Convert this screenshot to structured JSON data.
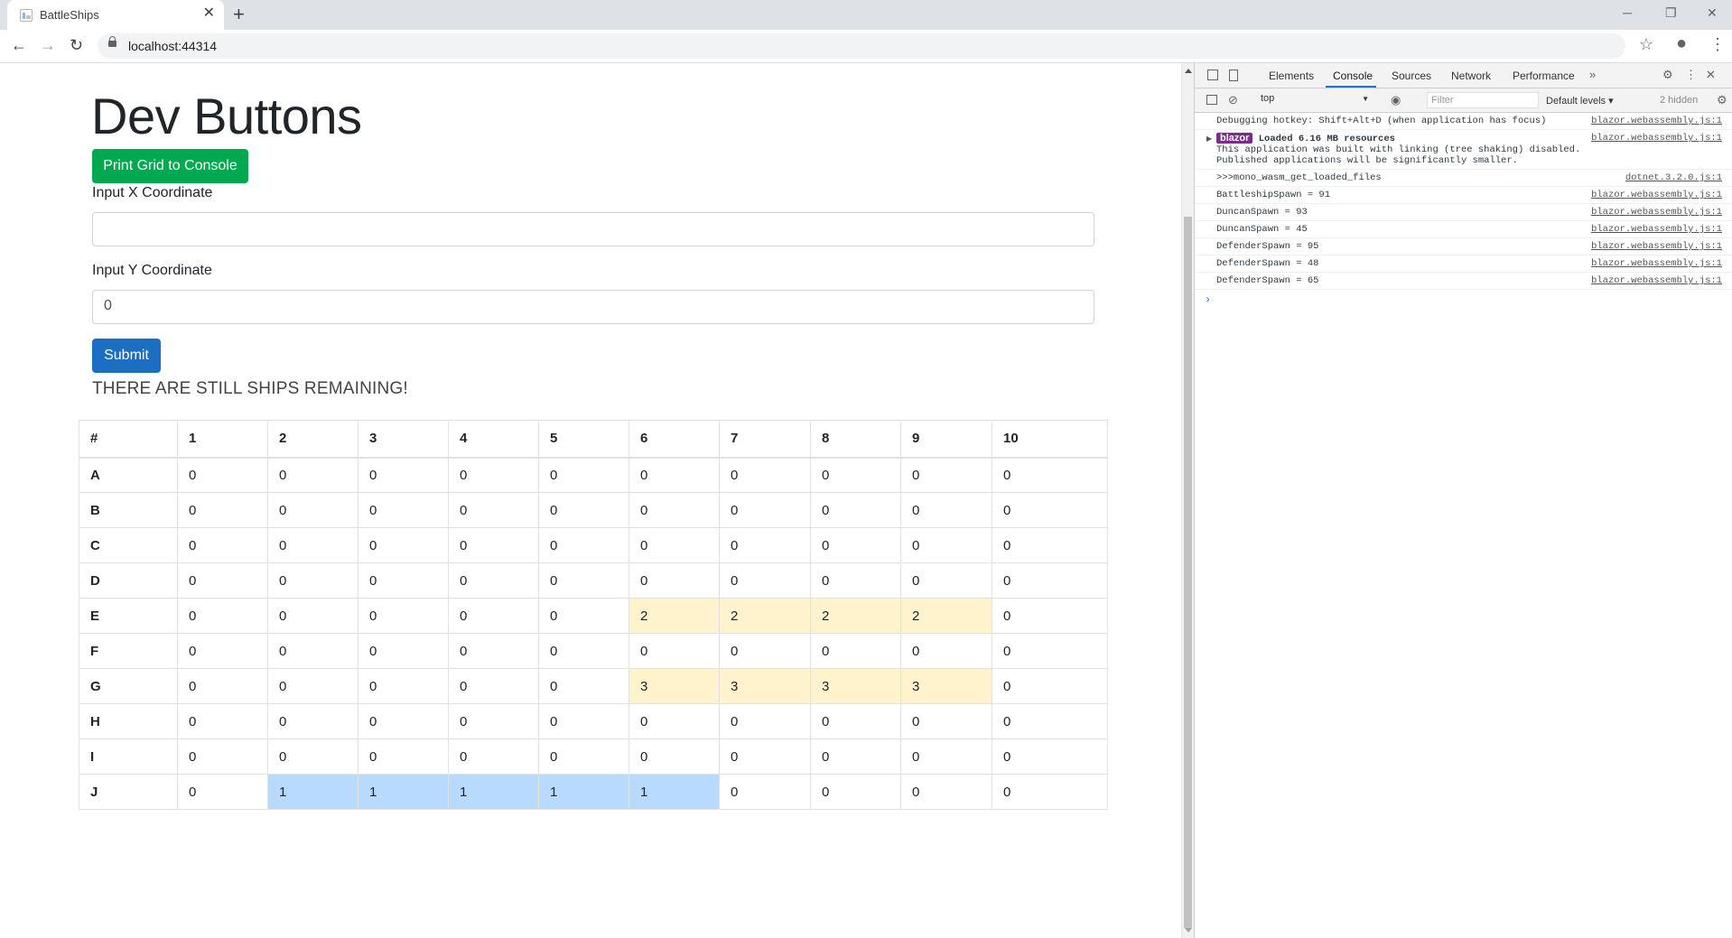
{
  "browser": {
    "tab_title": "BattleShips",
    "tab_close": "✕",
    "new_tab": "+",
    "url": "localhost:44314",
    "controls": {
      "minimize": "─",
      "maximize": "❐",
      "close": "✕"
    },
    "nav": {
      "back": "←",
      "forward": "→",
      "reload": "↻"
    },
    "toolbar_icons": {
      "star": "☆",
      "profile": "●",
      "menu": "⋮"
    }
  },
  "page": {
    "cut_text": "ʻ",
    "heading": "Dev Buttons",
    "print_button": "Print Grid to Console",
    "x_label": "Input X Coordinate",
    "x_value": "",
    "y_label": "Input Y Coordinate",
    "y_value": "0",
    "submit_button": "Submit",
    "status": "THERE ARE STILL SHIPS REMAINING!",
    "grid": {
      "headers": [
        "#",
        "1",
        "2",
        "3",
        "4",
        "5",
        "6",
        "7",
        "8",
        "9",
        "10"
      ],
      "rows": [
        {
          "label": "A",
          "cells": [
            "0",
            "0",
            "0",
            "0",
            "0",
            "0",
            "0",
            "0",
            "0",
            "0"
          ]
        },
        {
          "label": "B",
          "cells": [
            "0",
            "0",
            "0",
            "0",
            "0",
            "0",
            "0",
            "0",
            "0",
            "0"
          ]
        },
        {
          "label": "C",
          "cells": [
            "0",
            "0",
            "0",
            "0",
            "0",
            "0",
            "0",
            "0",
            "0",
            "0"
          ]
        },
        {
          "label": "D",
          "cells": [
            "0",
            "0",
            "0",
            "0",
            "0",
            "0",
            "0",
            "0",
            "0",
            "0"
          ]
        },
        {
          "label": "E",
          "cells": [
            "0",
            "0",
            "0",
            "0",
            "0",
            "2",
            "2",
            "2",
            "2",
            "0"
          ]
        },
        {
          "label": "F",
          "cells": [
            "0",
            "0",
            "0",
            "0",
            "0",
            "0",
            "0",
            "0",
            "0",
            "0"
          ]
        },
        {
          "label": "G",
          "cells": [
            "0",
            "0",
            "0",
            "0",
            "0",
            "3",
            "3",
            "3",
            "3",
            "0"
          ]
        },
        {
          "label": "H",
          "cells": [
            "0",
            "0",
            "0",
            "0",
            "0",
            "0",
            "0",
            "0",
            "0",
            "0"
          ]
        },
        {
          "label": "I",
          "cells": [
            "0",
            "0",
            "0",
            "0",
            "0",
            "0",
            "0",
            "0",
            "0",
            "0"
          ]
        },
        {
          "label": "J",
          "cells": [
            "0",
            "1",
            "1",
            "1",
            "1",
            "1",
            "0",
            "0",
            "0",
            "0"
          ]
        }
      ]
    }
  },
  "devtools": {
    "tabs": [
      "Elements",
      "Console",
      "Sources",
      "Network",
      "Performance"
    ],
    "more_tabs": "»",
    "context": "top",
    "filter_placeholder": "Filter",
    "levels": "Default levels ▾",
    "hidden": "2 hidden",
    "messages": [
      {
        "text": "Debugging hotkey: Shift+Alt+D (when application has focus)",
        "source": "blazor.webassembly.js:1"
      },
      {
        "badge": "blazor",
        "text": "Loaded 6.16 MB resources",
        "extra": "This application was built with linking (tree shaking) disabled. Published applications will be significantly smaller.",
        "source": "blazor.webassembly.js:1"
      },
      {
        "text": ">>>mono_wasm_get_loaded_files",
        "source": "dotnet.3.2.0.js:1"
      },
      {
        "text": "BattleshipSpawn = 91",
        "source": "blazor.webassembly.js:1"
      },
      {
        "text": "DuncanSpawn = 93",
        "source": "blazor.webassembly.js:1"
      },
      {
        "text": "DuncanSpawn = 45",
        "source": "blazor.webassembly.js:1"
      },
      {
        "text": "DefenderSpawn = 95",
        "source": "blazor.webassembly.js:1"
      },
      {
        "text": "DefenderSpawn = 48",
        "source": "blazor.webassembly.js:1"
      },
      {
        "text": "DefenderSpawn = 65",
        "source": "blazor.webassembly.js:1"
      }
    ],
    "prompt": "›"
  },
  "colors": {
    "ship_yellow": "#fff3cd",
    "ship_blue": "#b8daff",
    "print_btn": "#00a84f",
    "submit_btn": "#1b6ec2"
  }
}
